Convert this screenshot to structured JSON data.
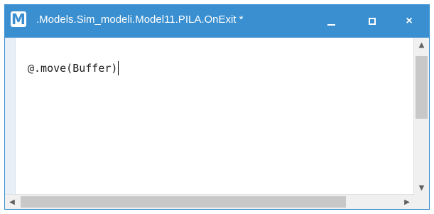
{
  "window": {
    "title": ".Models.Sim_modeli.Model11.PILA.OnExit *",
    "app_logo_letter": "M",
    "accent_color": "#3a8fd0",
    "controls": {
      "minimize_icon": "minimize-icon",
      "maximize_icon": "maximize-icon",
      "close_icon": "close-icon",
      "close_glyph": "×"
    }
  },
  "editor": {
    "code": "@.move(Buffer)"
  },
  "scrollbars": {
    "up_arrow": "▲",
    "down_arrow": "▼",
    "left_arrow": "◀",
    "right_arrow": "▶"
  }
}
